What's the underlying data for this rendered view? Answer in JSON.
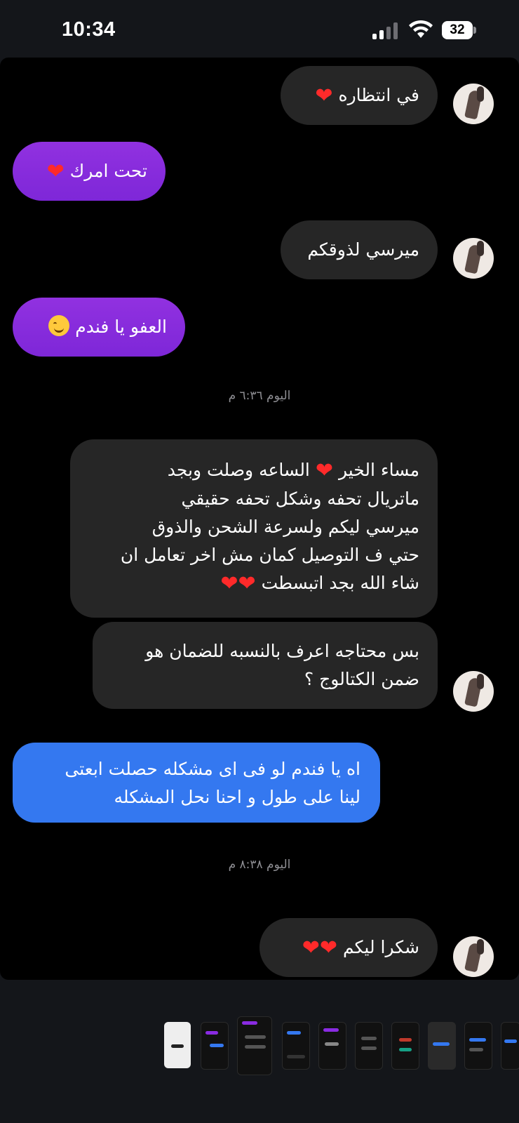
{
  "status_bar": {
    "time": "10:34",
    "battery": "32"
  },
  "messages": [
    {
      "side": "in",
      "text": "في انتظاره",
      "heart": "❤"
    },
    {
      "side": "out",
      "text": "تحت امرك",
      "heart": "❤"
    },
    {
      "side": "in",
      "text": "ميرسي لذوقكم"
    },
    {
      "side": "out",
      "text": "العفو يا فندم",
      "emoji": "smiling-face"
    },
    {
      "stamp": "اليوم ٦:٣٦ م"
    },
    {
      "side": "in",
      "lines": [
        "مساء الخير",
        "الساعه وصلت وبجد",
        "ماتريال تحفه وشكل تحفه حقيقي",
        "ميرسي ليكم ولسرعة الشحن والذوق",
        "حتي ف التوصيل كمان مش اخر تعامل ان",
        "شاء الله بجد اتبسطت"
      ]
    },
    {
      "side": "in",
      "lines": [
        "بس محتاجه اعرف بالنسبه للضمان هو",
        "ضمن الكتالوج ؟"
      ]
    },
    {
      "side": "out",
      "color": "#3478f0",
      "lines": [
        "اه يا فندم لو فى اى مشكله حصلت ابعتى",
        "لينا على طول و احنا نحل المشكله"
      ]
    },
    {
      "stamp": "اليوم ٨:٣٨ م"
    },
    {
      "side": "in",
      "text": "شكرا ليكم"
    }
  ],
  "heart_glyph": "❤",
  "colors": {
    "incoming": "#262626",
    "outgoing_purple": "#8a2be2",
    "outgoing_blue": "#3478f0",
    "heart": "#ff2a2a"
  }
}
